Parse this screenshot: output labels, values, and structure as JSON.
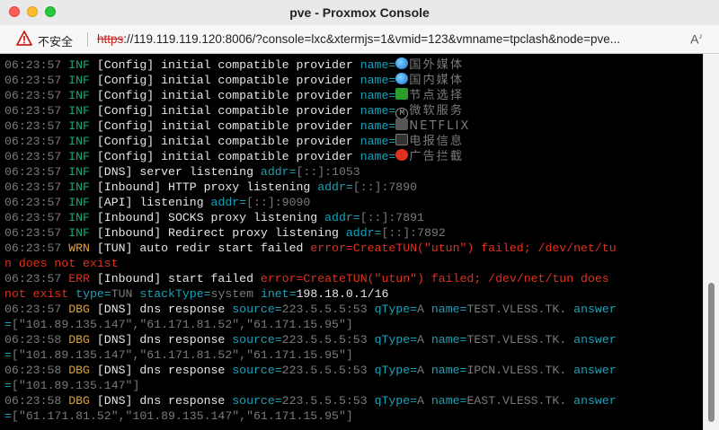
{
  "window": {
    "title": "pve - Proxmox Console"
  },
  "addressbar": {
    "insecure_label": "不安全",
    "url_scheme": "https",
    "url_rest": "://119.119.119.120:8006/?console=lxc&xtermjs=1&vmid=123&vmname=tpclash&node=pve...",
    "reader_icon_text": "A"
  },
  "terminal": {
    "lines": [
      {
        "ts": "06:23:57",
        "lvl": "INF",
        "lc": "inf",
        "segs": [
          {
            "t": " [Config] initial compatible provider "
          },
          {
            "t": "name=",
            "c": "key"
          },
          {
            "icon": "e-globe"
          },
          {
            "t": "国外媒体",
            "c": "cjk"
          }
        ]
      },
      {
        "ts": "06:23:57",
        "lvl": "INF",
        "lc": "inf",
        "segs": [
          {
            "t": " [Config] initial compatible provider "
          },
          {
            "t": "name=",
            "c": "key"
          },
          {
            "icon": "e-globe"
          },
          {
            "t": "国内媒体",
            "c": "cjk"
          }
        ]
      },
      {
        "ts": "06:23:57",
        "lvl": "INF",
        "lc": "inf",
        "segs": [
          {
            "t": " [Config] initial compatible provider "
          },
          {
            "t": "name=",
            "c": "key"
          },
          {
            "icon": "e-pin"
          },
          {
            "t": "节点选择",
            "c": "cjk"
          }
        ]
      },
      {
        "ts": "06:23:57",
        "lvl": "INF",
        "lc": "inf",
        "segs": [
          {
            "t": " [Config] initial compatible provider "
          },
          {
            "t": "name=",
            "c": "key"
          },
          {
            "icon": "e-m",
            "it": "M"
          },
          {
            "t": "微软服务",
            "c": "cjk"
          }
        ]
      },
      {
        "ts": "06:23:57",
        "lvl": "INF",
        "lc": "inf",
        "segs": [
          {
            "t": " [Config] initial compatible provider "
          },
          {
            "t": "name=",
            "c": "key"
          },
          {
            "icon": "e-film"
          },
          {
            "t": "NETFLIX",
            "c": "cjk"
          }
        ]
      },
      {
        "ts": "06:23:57",
        "lvl": "INF",
        "lc": "inf",
        "segs": [
          {
            "t": " [Config] initial compatible provider "
          },
          {
            "t": "name=",
            "c": "key"
          },
          {
            "icon": "e-radio"
          },
          {
            "t": "电报信息",
            "c": "cjk"
          }
        ]
      },
      {
        "ts": "06:23:57",
        "lvl": "INF",
        "lc": "inf",
        "segs": [
          {
            "t": " [Config] initial compatible provider "
          },
          {
            "t": "name=",
            "c": "key"
          },
          {
            "icon": "e-stop"
          },
          {
            "t": "广告拦截",
            "c": "cjk"
          }
        ]
      },
      {
        "ts": "06:23:57",
        "lvl": "INF",
        "lc": "inf",
        "segs": [
          {
            "t": " [DNS] server listening "
          },
          {
            "t": "addr=",
            "c": "key"
          },
          {
            "t": "[::]:1053",
            "c": "val"
          }
        ]
      },
      {
        "ts": "06:23:57",
        "lvl": "INF",
        "lc": "inf",
        "segs": [
          {
            "t": " [Inbound] HTTP proxy listening "
          },
          {
            "t": "addr=",
            "c": "key"
          },
          {
            "t": "[::]:7890",
            "c": "val"
          }
        ]
      },
      {
        "ts": "06:23:57",
        "lvl": "INF",
        "lc": "inf",
        "segs": [
          {
            "t": " [API] listening "
          },
          {
            "t": "addr=",
            "c": "key"
          },
          {
            "t": "[::]:9090",
            "c": "val"
          }
        ]
      },
      {
        "ts": "06:23:57",
        "lvl": "INF",
        "lc": "inf",
        "segs": [
          {
            "t": " [Inbound] SOCKS proxy listening "
          },
          {
            "t": "addr=",
            "c": "key"
          },
          {
            "t": "[::]:7891",
            "c": "val"
          }
        ]
      },
      {
        "ts": "06:23:57",
        "lvl": "INF",
        "lc": "inf",
        "segs": [
          {
            "t": " [Inbound] Redirect proxy listening "
          },
          {
            "t": "addr=",
            "c": "key"
          },
          {
            "t": "[::]:7892",
            "c": "val"
          }
        ]
      },
      {
        "ts": "06:23:57",
        "lvl": "WRN",
        "lc": "wrn",
        "segs": [
          {
            "t": " [TUN] auto redir start failed "
          },
          {
            "t": "error=CreateTUN(\"utun\") failed; /dev/net/tu",
            "c": "errtext"
          }
        ]
      },
      {
        "segs": [
          {
            "t": "n does not exist",
            "c": "errtext"
          }
        ]
      },
      {
        "ts": "06:23:57",
        "lvl": "ERR",
        "lc": "err",
        "segs": [
          {
            "t": " [Inbound] start failed "
          },
          {
            "t": "error=CreateTUN(\"utun\") failed; /dev/net/tun does",
            "c": "errtext"
          }
        ]
      },
      {
        "segs": [
          {
            "t": "not exist",
            "c": "errtext"
          },
          {
            "t": " "
          },
          {
            "t": "type=",
            "c": "key"
          },
          {
            "t": "TUN ",
            "c": "val"
          },
          {
            "t": "stackType=",
            "c": "key"
          },
          {
            "t": "system ",
            "c": "val"
          },
          {
            "t": "inet=",
            "c": "key"
          },
          {
            "t": "198.18.0.1/16"
          }
        ]
      },
      {
        "ts": "06:23:57",
        "lvl": "DBG",
        "lc": "dbg",
        "segs": [
          {
            "t": " [DNS] dns response "
          },
          {
            "t": "source=",
            "c": "key"
          },
          {
            "t": "223.5.5.5:53 ",
            "c": "val"
          },
          {
            "t": "qType=",
            "c": "key"
          },
          {
            "t": "A ",
            "c": "val"
          },
          {
            "t": "name=",
            "c": "key"
          },
          {
            "t": "TEST.VLESS.TK. ",
            "c": "val"
          },
          {
            "t": "answer",
            "c": "key"
          }
        ]
      },
      {
        "segs": [
          {
            "t": "=",
            "c": "key"
          },
          {
            "t": "[\"101.89.135.147\",\"61.171.81.52\",\"61.171.15.95\"]",
            "c": "val"
          }
        ]
      },
      {
        "ts": "06:23:58",
        "lvl": "DBG",
        "lc": "dbg",
        "segs": [
          {
            "t": " [DNS] dns response "
          },
          {
            "t": "source=",
            "c": "key"
          },
          {
            "t": "223.5.5.5:53 ",
            "c": "val"
          },
          {
            "t": "qType=",
            "c": "key"
          },
          {
            "t": "A ",
            "c": "val"
          },
          {
            "t": "name=",
            "c": "key"
          },
          {
            "t": "TEST.VLESS.TK. ",
            "c": "val"
          },
          {
            "t": "answer",
            "c": "key"
          }
        ]
      },
      {
        "segs": [
          {
            "t": "=",
            "c": "key"
          },
          {
            "t": "[\"101.89.135.147\",\"61.171.81.52\",\"61.171.15.95\"]",
            "c": "val"
          }
        ]
      },
      {
        "ts": "06:23:58",
        "lvl": "DBG",
        "lc": "dbg",
        "segs": [
          {
            "t": " [DNS] dns response "
          },
          {
            "t": "source=",
            "c": "key"
          },
          {
            "t": "223.5.5.5:53 ",
            "c": "val"
          },
          {
            "t": "qType=",
            "c": "key"
          },
          {
            "t": "A ",
            "c": "val"
          },
          {
            "t": "name=",
            "c": "key"
          },
          {
            "t": "IPCN.VLESS.TK. ",
            "c": "val"
          },
          {
            "t": "answer",
            "c": "key"
          }
        ]
      },
      {
        "segs": [
          {
            "t": "=",
            "c": "key"
          },
          {
            "t": "[\"101.89.135.147\"]",
            "c": "val"
          }
        ]
      },
      {
        "ts": "06:23:58",
        "lvl": "DBG",
        "lc": "dbg",
        "segs": [
          {
            "t": " [DNS] dns response "
          },
          {
            "t": "source=",
            "c": "key"
          },
          {
            "t": "223.5.5.5:53 ",
            "c": "val"
          },
          {
            "t": "qType=",
            "c": "key"
          },
          {
            "t": "A ",
            "c": "val"
          },
          {
            "t": "name=",
            "c": "key"
          },
          {
            "t": "EAST.VLESS.TK. ",
            "c": "val"
          },
          {
            "t": "answer",
            "c": "key"
          }
        ]
      },
      {
        "segs": [
          {
            "t": "=",
            "c": "key"
          },
          {
            "t": "[\"61.171.81.52\",\"101.89.135.147\",\"61.171.15.95\"]",
            "c": "val"
          }
        ]
      }
    ]
  },
  "colors": {
    "terminal_bg": "#000000",
    "timestamp": "#7a7a7a",
    "info": "#19a974",
    "warn": "#e8a33a",
    "error": "#e0301e",
    "debug": "#d8a03a",
    "key": "#17a2b8"
  }
}
